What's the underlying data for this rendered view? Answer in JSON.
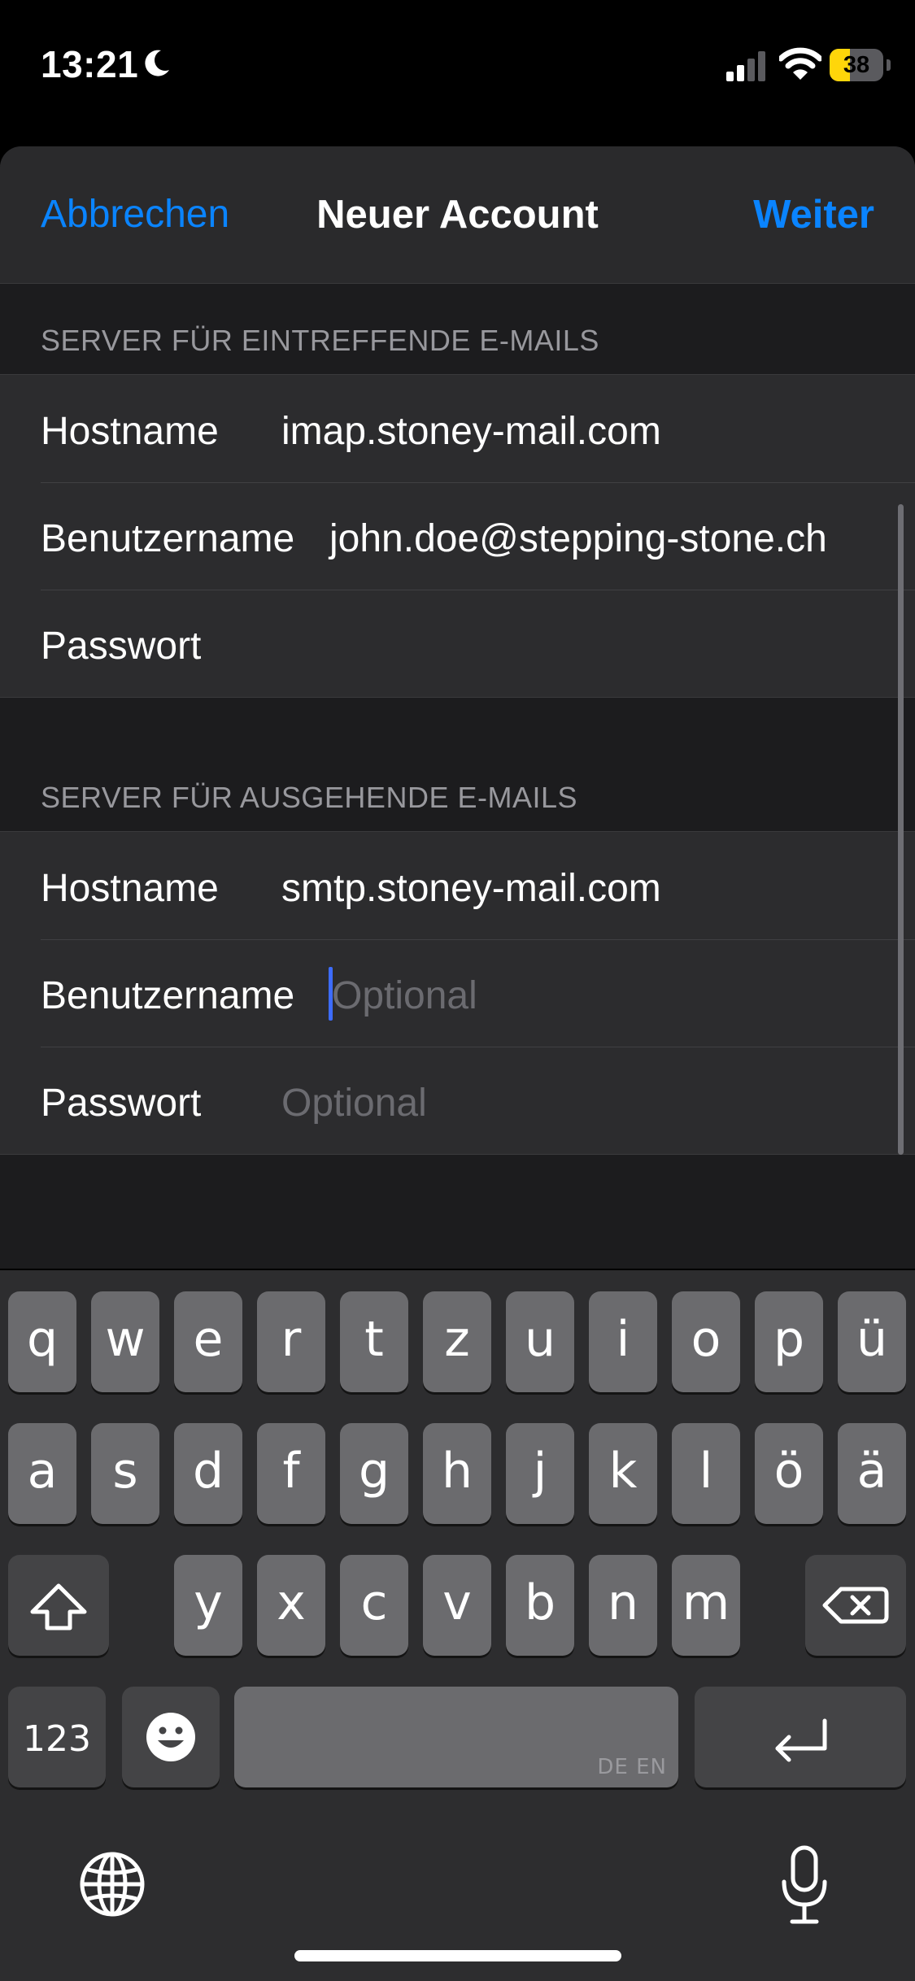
{
  "status_bar": {
    "time": "13:21",
    "battery_percent": 38,
    "battery_label": "38",
    "icons": [
      "moon-icon",
      "cellular-signal-icon",
      "wifi-icon",
      "battery-icon"
    ]
  },
  "nav": {
    "cancel_label": "Abbrechen",
    "title": "Neuer Account",
    "next_label": "Weiter",
    "accent_color": "#0a84ff"
  },
  "incoming": {
    "header": "SERVER FÜR EINTREFFENDE E-MAILS",
    "rows": [
      {
        "label": "Hostname",
        "value": "imap.stoney-mail.com"
      },
      {
        "label": "Benutzername",
        "value": "john.doe@stepping-stone.ch"
      },
      {
        "label": "Passwort",
        "value": ""
      }
    ]
  },
  "outgoing": {
    "header": "SERVER FÜR AUSGEHENDE E-MAILS",
    "rows": [
      {
        "label": "Hostname",
        "value": "smtp.stoney-mail.com"
      },
      {
        "label": "Benutzername",
        "placeholder": "Optional"
      },
      {
        "label": "Passwort",
        "placeholder": "Optional"
      }
    ]
  },
  "keyboard": {
    "row1": [
      "q",
      "w",
      "e",
      "r",
      "t",
      "z",
      "u",
      "i",
      "o",
      "p",
      "ü"
    ],
    "row2": [
      "a",
      "s",
      "d",
      "f",
      "g",
      "h",
      "j",
      "k",
      "l",
      "ö",
      "ä"
    ],
    "row3": [
      "y",
      "x",
      "c",
      "v",
      "b",
      "n",
      "m"
    ],
    "numbers_label": "123",
    "space_lang_label": "DE EN",
    "icons": [
      "shift-icon",
      "backspace-icon",
      "emoji-icon",
      "return-icon",
      "globe-icon",
      "microphone-icon"
    ]
  }
}
